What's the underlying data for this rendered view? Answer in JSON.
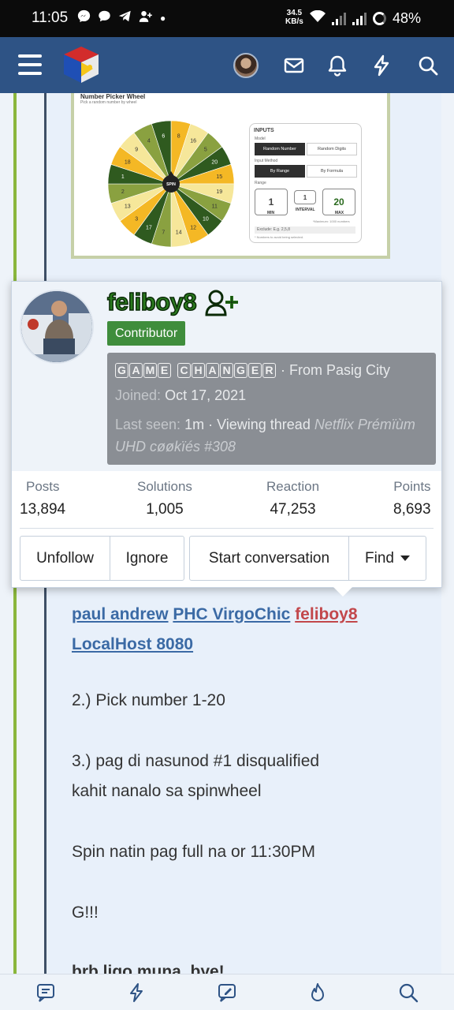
{
  "status_bar": {
    "time": "11:05",
    "net_speed": "34.5",
    "net_unit": "KB/s",
    "battery": "48%"
  },
  "header": {
    "icons": [
      "menu-icon",
      "site-logo",
      "user-avatar",
      "mail-icon",
      "bell-icon",
      "bolt-icon",
      "search-icon"
    ]
  },
  "embedded_image": {
    "title": "Number Picker Wheel",
    "subtitle": "Pick a random number by wheel",
    "wheel_numbers": [
      "8",
      "16",
      "5",
      "20",
      "15",
      "19",
      "11",
      "10",
      "12",
      "14",
      "7",
      "17",
      "3",
      "13",
      "2",
      "1",
      "18",
      "9",
      "4",
      "6"
    ],
    "spin_label": "SPIN",
    "inputs": {
      "title": "INPUTS",
      "model_label": "Model",
      "model_options": [
        "Random Number",
        "Random Digits"
      ],
      "method_label": "Input Method",
      "method_options": [
        "By Range",
        "By Formula"
      ],
      "range_label": "Range",
      "min": "1",
      "interval": "1",
      "max": "20",
      "min_label": "MIN",
      "interval_label": "INTERVAL",
      "max_label": "MAX",
      "maximum_note": "*Maximum: 1000 numbers",
      "exclude_placeholder": "Exclude: E.g. 2,5,8",
      "exclude_note": "* Numbers to avoid being selected."
    }
  },
  "member_card": {
    "username": "feliboy8",
    "role_badge": "Contributor",
    "game_changer": "GAME CHANGER",
    "from": "· From Pasig City",
    "joined_label": "Joined:",
    "joined_date": "Oct 17, 2021",
    "last_seen_label": "Last seen:",
    "last_seen_value": "1m · Viewing thread",
    "thread_title": "Netflix Prémïùm UHD cøøkïés #308",
    "stats": [
      {
        "label": "Posts",
        "value": "13,894"
      },
      {
        "label": "Solutions",
        "value": "1,005"
      },
      {
        "label": "Reaction",
        "value": "47,253"
      },
      {
        "label": "Points",
        "value": "8,693"
      }
    ],
    "buttons": {
      "unfollow": "Unfollow",
      "ignore": "Ignore",
      "start_conversation": "Start conversation",
      "find": "Find"
    }
  },
  "post": {
    "mentions": [
      "paul andrew",
      "PHC VirgoChic",
      "feliboy8",
      "LocalHost 8080"
    ],
    "line2": "2.) Pick number 1-20",
    "line3a": "3.) pag di nasunod #1 disqualified",
    "line3b": "kahit nanalo sa spinwheel",
    "line4": "Spin natin pag full na or 11:30PM",
    "line5": "G!!!",
    "line6": "brb ligo muna, bye!"
  },
  "bottom_nav": [
    "forums-icon",
    "whats-new-icon",
    "post-thread-icon",
    "trending-icon",
    "search-icon"
  ]
}
